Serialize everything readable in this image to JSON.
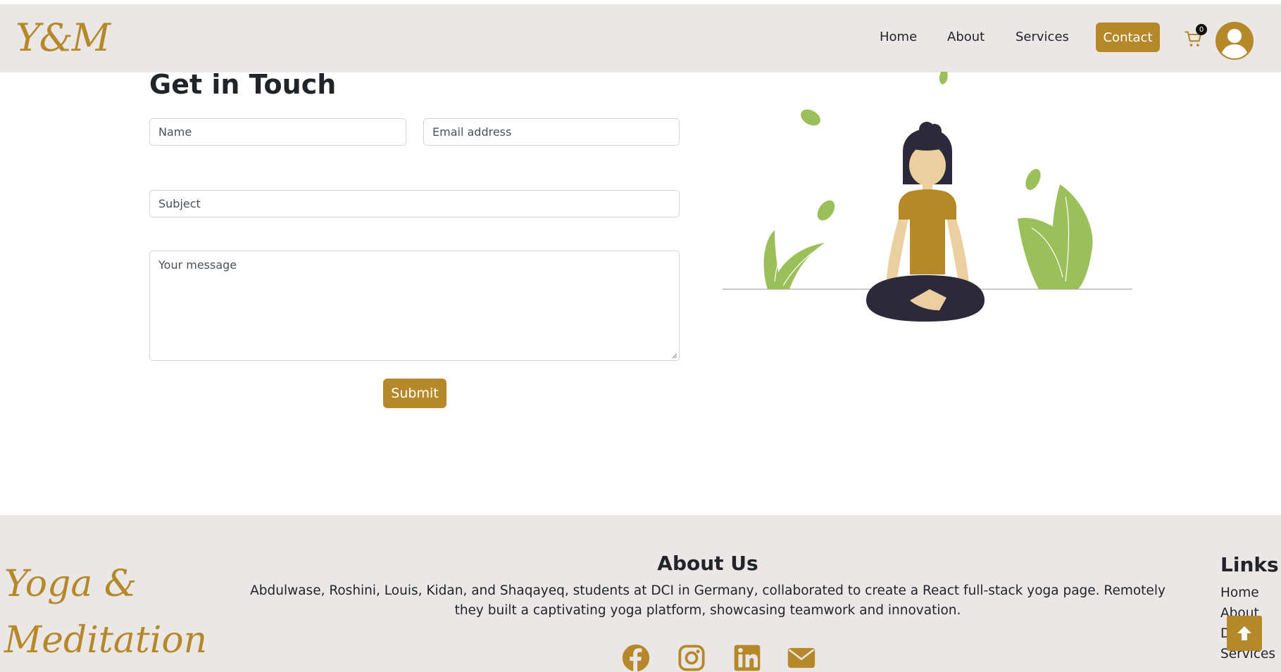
{
  "header": {
    "logo": "Y&M",
    "nav": [
      "Home",
      "About",
      "Services"
    ],
    "contact_label": "Contact",
    "cart_count": "0"
  },
  "form": {
    "title": "Get in Touch",
    "name_placeholder": "Name",
    "email_placeholder": "Email address",
    "subject_placeholder": "Subject",
    "message_placeholder": "Your message",
    "submit_label": "Submit"
  },
  "footer": {
    "logo_line1": "Yoga &",
    "logo_line2": "Meditation",
    "about_title": "About Us",
    "about_text": "Abdulwase, Roshini, Louis, Kidan, and Shaqayeq, students at DCI in Germany, collaborated to create a React full-stack yoga page. Remotely they built a captivating yoga platform, showcasing teamwork and innovation.",
    "social_icons": [
      "facebook-icon",
      "instagram-icon",
      "linkedin-icon",
      "email-icon"
    ],
    "links_title": "Links",
    "links": [
      "Home",
      "About",
      "D",
      "Services"
    ]
  },
  "colors": {
    "accent": "#b5892a",
    "header_bg": "#ebe7e6",
    "leaf_green": "#9bbf5a",
    "dark": "#2c2a3a",
    "skin": "#ebcfa1"
  }
}
